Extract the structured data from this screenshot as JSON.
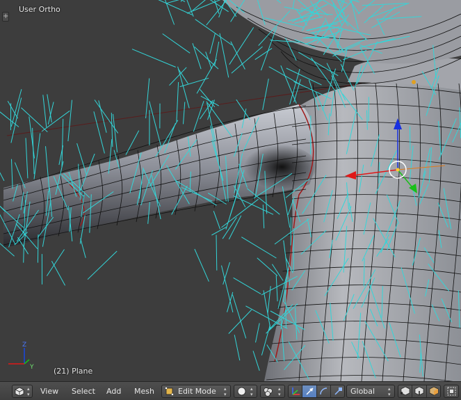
{
  "viewport": {
    "view_name": "User Ortho",
    "object_label": "(21) Plane",
    "toolshelf_toggle": "+",
    "axis_labels": {
      "z": "Z",
      "y": "Y"
    },
    "colors": {
      "background": "#3d3d3d",
      "hair": "#33d6d9",
      "mesh_wire": "#101010",
      "seam": "#a01818",
      "manipulator_x": "#e01818",
      "manipulator_y": "#18c018",
      "manipulator_z": "#1830e0"
    }
  },
  "header": {
    "editor_type_icon": "cube-icon",
    "menus": [
      "View",
      "Select",
      "Add",
      "Mesh"
    ],
    "mode": {
      "label": "Edit Mode",
      "icon": "edit-mode-icon"
    },
    "pivot_icon": "sphere-shading-icon",
    "pivot_point_icon": "pivot-point-icon",
    "manipulator_icons": [
      "manipulator-toggle-icon",
      "translate-icon",
      "rotate-icon",
      "scale-icon"
    ],
    "orientation": "Global",
    "select_mode_icons": [
      "vertex-select-icon",
      "edge-select-icon",
      "face-select-icon"
    ],
    "occlude_icon": "occlude-geometry-icon"
  }
}
